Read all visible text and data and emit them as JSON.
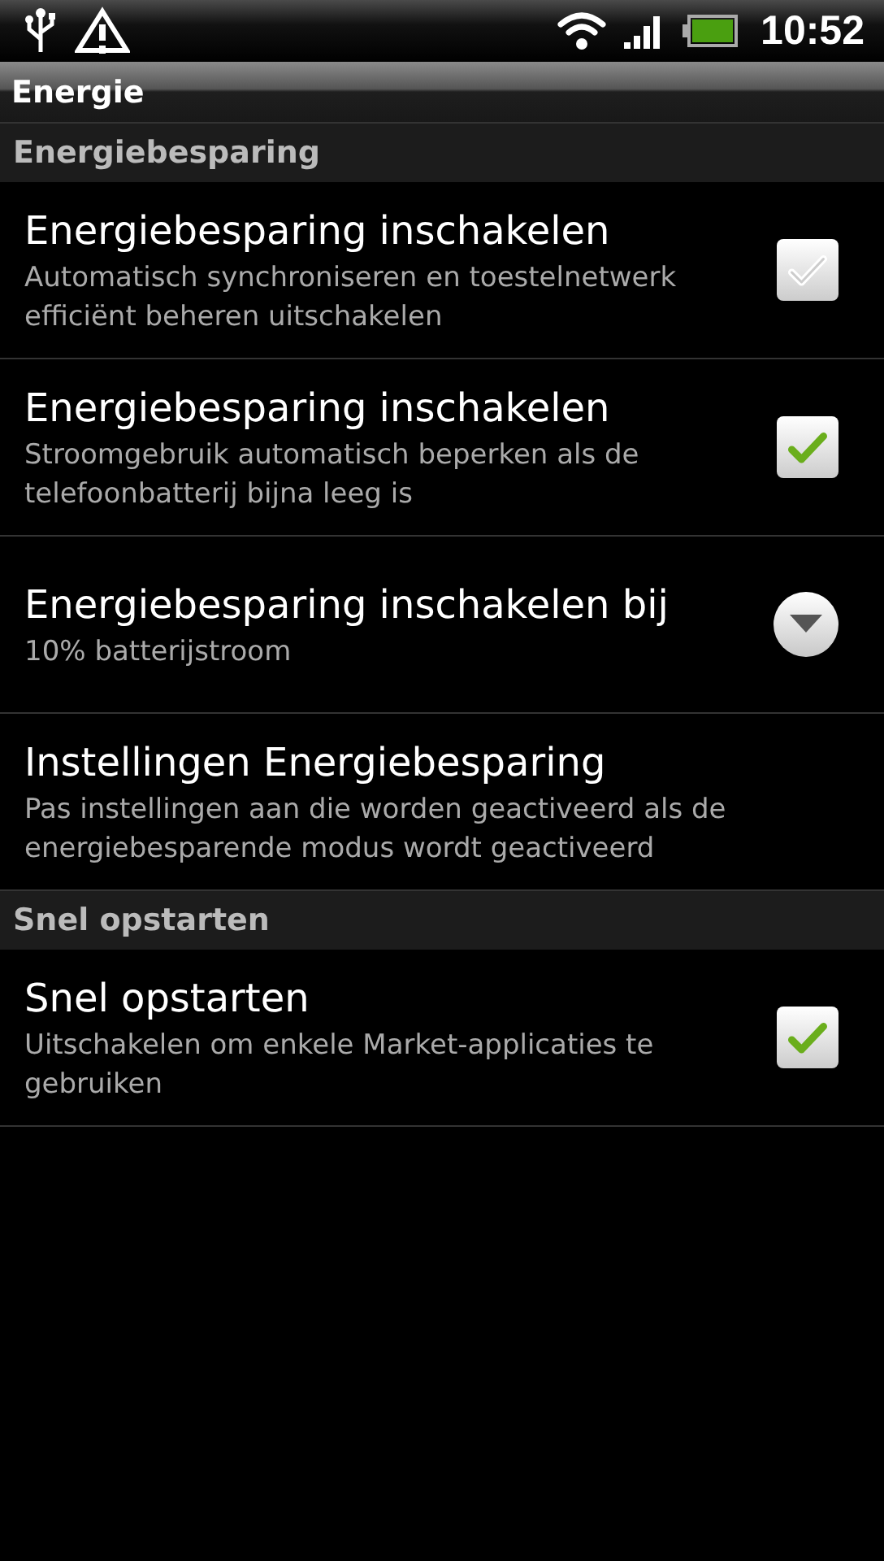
{
  "status_bar": {
    "time": "10:52"
  },
  "window": {
    "title": "Energie"
  },
  "sections": [
    {
      "header": "Energiebesparing",
      "items": [
        {
          "kind": "checkbox",
          "title": "Energiebesparing inschakelen",
          "summary": "Automatisch synchroniseren en toestelnetwerk efficiënt beheren uitschakelen",
          "checked": false
        },
        {
          "kind": "checkbox",
          "title": "Energiebesparing inschakelen",
          "summary": "Stroomgebruik automatisch beperken als de telefoonbatterij bijna leeg is",
          "checked": true
        },
        {
          "kind": "dropdown",
          "title": "Energiebesparing inschakelen bij",
          "summary": "10% batterijstroom"
        },
        {
          "kind": "plain",
          "title": "Instellingen Energiebesparing",
          "summary": "Pas instellingen aan die worden geactiveerd als de energiebesparende modus wordt geactiveerd"
        }
      ]
    },
    {
      "header": "Snel opstarten",
      "items": [
        {
          "kind": "checkbox",
          "title": "Snel opstarten",
          "summary": "Uitschakelen om enkele Market-applicaties te gebruiken",
          "checked": true
        }
      ]
    }
  ]
}
